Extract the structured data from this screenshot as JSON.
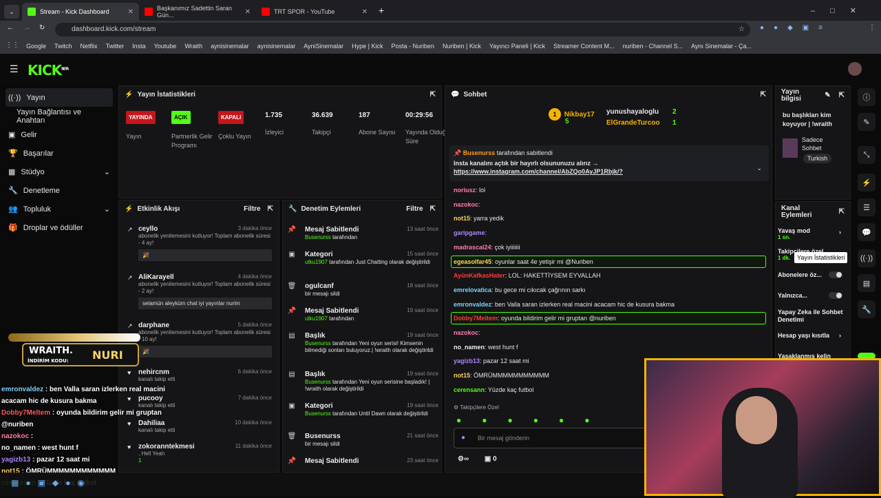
{
  "browser": {
    "tabs": [
      {
        "title": "Stream - Kick Dashboard"
      },
      {
        "title": "Başkanımız Sadettin Saran Gün..."
      },
      {
        "title": "TRT SPOR - YouTube"
      }
    ],
    "url": "dashboard.kick.com/stream",
    "bookmarks": [
      "Google",
      "Twitch",
      "Netflix",
      "Twitter",
      "Insta",
      "Youtube",
      "Wraith",
      "aynisinemalar",
      "aynisinemalar",
      "AyniSinemalar",
      "Hype | Kick",
      "Posta - Nuriben",
      "Nuriben | Kick",
      "Yayıncı Paneli | Kick",
      "Streamer Content M...",
      "nuriben - Channel S...",
      "Aynı Sinemalar - Ça..."
    ]
  },
  "brand": {
    "logo": "KICK",
    "beta": "BETA",
    "accent": "#53fc18"
  },
  "sidebar": {
    "items": [
      {
        "label": "Yayın"
      },
      {
        "label": "Yayın Bağlantısı ve Anahtarı"
      },
      {
        "label": "Gelir"
      },
      {
        "label": "Başarılar"
      },
      {
        "label": "Stüdyo"
      },
      {
        "label": "Denetleme"
      },
      {
        "label": "Topluluk"
      },
      {
        "label": "Droplar ve ödüller"
      }
    ]
  },
  "stats": {
    "title": "Yayın İstatistikleri",
    "cols": [
      {
        "pill": "YAYINDA",
        "label": "Yayın",
        "color": "#c4161c"
      },
      {
        "pill": "AÇIK",
        "label": "Partnerlik Gelir Programı",
        "color": "#53fc18"
      },
      {
        "pill": "KAPALI",
        "label": "Çoklu Yayın",
        "color": "#c4161c"
      },
      {
        "value": "1.735",
        "label": "İzleyici"
      },
      {
        "value": "36.639",
        "label": "Takipçi"
      },
      {
        "value": "187",
        "label": "Abone Sayısı"
      },
      {
        "value": "00:29:56",
        "label": "Yayında Olduğu Süre"
      }
    ]
  },
  "activity": {
    "title": "Etkinlik Akışı",
    "filter": "Filtre",
    "events": [
      {
        "name": "ceyllo",
        "time": "3 dakika önce",
        "desc": "abonelik yenilemesini kutluyor! Toplam abonelik süresi - 4 ay!",
        "box": "🎉"
      },
      {
        "name": "AliKarayell",
        "time": "4 dakika önce",
        "desc": "abonelik yenilemesini kutluyor! Toplam abonelik süresi - 2 ay!",
        "box": "selamün aleyküm chat iyi yayınlar nurim"
      },
      {
        "name": "darphane",
        "time": "5 dakika önce",
        "desc": "abonelik yenilemesini kutluyor! Toplam abonelik süresi - 10 ay!",
        "box": "🎉"
      },
      {
        "name": "nehircnm",
        "time": "6 dakika önce",
        "desc": "kanalı takip etti"
      },
      {
        "name": "pucooy",
        "time": "7 dakika önce",
        "desc": "kanalı takip etti"
      },
      {
        "name": "Dahiliaa",
        "time": "10 dakika önce",
        "desc": "kanalı takip etti"
      },
      {
        "name": "zokoranntekmesi",
        "time": "11 dakika önce",
        "desc": ", Hell Yeah",
        "count": "1"
      }
    ]
  },
  "modactions": {
    "title": "Denetim Eylemleri",
    "filter": "Filtre",
    "items": [
      {
        "icon": "📌",
        "name": "Mesaj Sabitlendi",
        "time": "13 saat önce",
        "by": "Busenurss",
        "desc": " tarafından"
      },
      {
        "icon": "▣",
        "name": "Kategori",
        "time": "15 saat önce",
        "by": "utku1907",
        "desc": " tarafından Just Chatting olarak değiştirildi"
      },
      {
        "icon": "🗑",
        "name": "ogulcanf",
        "time": "18 saat önce",
        "desc": "bir mesajı sildi"
      },
      {
        "icon": "📌",
        "name": "Mesaj Sabitlendi",
        "time": "19 saat önce",
        "by": "utku1907",
        "desc": " tarafından"
      },
      {
        "icon": "▤",
        "name": "Başlık",
        "time": "19 saat önce",
        "by": "Busenurss",
        "desc": " tarafından Yeni oyun serisi! Kimsenin bilmediği sonları buluyoruz.| !wraith olarak değiştirildi"
      },
      {
        "icon": "▤",
        "name": "Başlık",
        "time": "19 saat önce",
        "by": "Busenurss",
        "desc": " tarafından Yeni oyun serisine başladık! | !wraith olarak değiştirildi"
      },
      {
        "icon": "▣",
        "name": "Kategori",
        "time": "19 saat önce",
        "by": "Busenurss",
        "desc": " tarafından Until Dawn olarak değiştirildi"
      },
      {
        "icon": "🗑",
        "name": "Busenurss",
        "time": "21 saat önce",
        "desc": "bir mesajı sildi"
      },
      {
        "icon": "📌",
        "name": "Mesaj Sabitlendi",
        "time": "23 saat önce",
        "desc": ""
      }
    ]
  },
  "chat": {
    "title": "Sohbet",
    "top": [
      {
        "name": "Nikbay17",
        "count": "5"
      },
      {
        "name": "yunushayaloglu",
        "count": "2"
      },
      {
        "name": "ElGrandeTurcoo",
        "count": "1"
      }
    ],
    "pinned": {
      "by": "Busenurss",
      "suffix": "tarafından sabitlendi",
      "text": "Insta kanalını açtık bir hayırlı olsununuzu alırız →",
      "link": "https://www.instagram.com/channel/AbZQo0AyJP1Rbjk/?"
    },
    "messages": [
      {
        "user": "noriusz",
        "color": "#ff7db0",
        "text": "lol"
      },
      {
        "user": "nazokoc",
        "color": "#ff7db0",
        "text": ""
      },
      {
        "user": "not15",
        "color": "#ffd166",
        "text": "yarra yedik"
      },
      {
        "user": "garipgame",
        "color": "#b084ff",
        "text": ""
      },
      {
        "user": "madrascal24",
        "color": "#ff7db0",
        "text": "çok iyiiiiiii"
      },
      {
        "user": "egeasolfar45",
        "color": "#ffd166",
        "text": "oyunlar saat 4e yetişir mi @Nuriben"
      },
      {
        "user": "AyünKafkasHater",
        "color": "#ff3b3b",
        "text": "LOL: HAKETTİYSEM EYVALLAH"
      },
      {
        "user": "emrelovatica",
        "color": "#7dd3fc",
        "text": "bu gece mi cıkıcak çağrının sarkı"
      },
      {
        "user": "emronvaldez",
        "color": "#7dd3fc",
        "text": "ben Valla saran izlerken real macini acacam hic de kusura bakma"
      },
      {
        "user": "Dobby7Meltem",
        "color": "#ff3b3b",
        "text": "oyunda bildirim gelir mi gruptan @nuriben"
      },
      {
        "user": "nazokoc",
        "color": "#ff7db0",
        "text": ""
      },
      {
        "user": "no_namen",
        "color": "#eee",
        "text": "west hunt f"
      },
      {
        "user": "yagizb13",
        "color": "#b084ff",
        "text": "pazar 12 saat mi"
      },
      {
        "user": "not15",
        "color": "#ffd166",
        "text": "ÖMRÜMMMMMMMMMMM"
      },
      {
        "user": "cerensann",
        "color": "#53fc18",
        "text": "Yüzde kaç futbol"
      }
    ],
    "followers_only": "Takipçilere Özel",
    "placeholder": "Bir mesaj gönderin",
    "points": "0"
  },
  "info": {
    "title": "Yayın bilgisi",
    "stream_title": "bu başlıkları kim koyuyor | !wraith",
    "tags": [
      "Sadece Sohbet",
      "Turkish"
    ]
  },
  "channel": {
    "title": "Kanal Eylemleri",
    "items": [
      {
        "label": "Yavaş mod",
        "sub": "1 sn."
      },
      {
        "label": "Takipçilere özel",
        "sub": "1 dk."
      },
      {
        "label": "Abonelere öz..."
      },
      {
        "label": "Yalnızca..."
      },
      {
        "label": "Yapay Zeka ile Sohbet Denetimi"
      },
      {
        "label": "Hesap yaşı kısıtla"
      },
      {
        "label": "Yasaklanmış kelin"
      }
    ],
    "tooltip": "Yayın İstatistikleri"
  },
  "overlay": {
    "brand": "WRAITH.",
    "code_label": "İNDİRİM KODU:",
    "code": "NURI",
    "lines": [
      {
        "user": "emronvaldez",
        "color": "#7dd3fc",
        "text": ": ben Valla saran izlerken real macini"
      },
      {
        "user": "",
        "color": "#fff",
        "text": "acacam hic de kusura bakma"
      },
      {
        "user": "Dobby7Meltem",
        "color": "#ff5a5a",
        "text": ": oyunda bildirim gelir mi gruptan"
      },
      {
        "user": "",
        "color": "#fff",
        "text": "@nuriben"
      },
      {
        "user": "nazokoc",
        "color": "#ff7db0",
        "text": ":"
      },
      {
        "user": "no_namen",
        "color": "#fff",
        "text": ": west hunt f"
      },
      {
        "user": "yagizb13",
        "color": "#b084ff",
        "text": ": pazar 12 saat mi"
      },
      {
        "user": "not15",
        "color": "#ffd166",
        "text": ": ÖMRÜMMMMMMMMMMMM"
      },
      {
        "user": "cerensann",
        "color": "#53fc18",
        "text": ": Yüzde kaç futbol"
      }
    ]
  }
}
